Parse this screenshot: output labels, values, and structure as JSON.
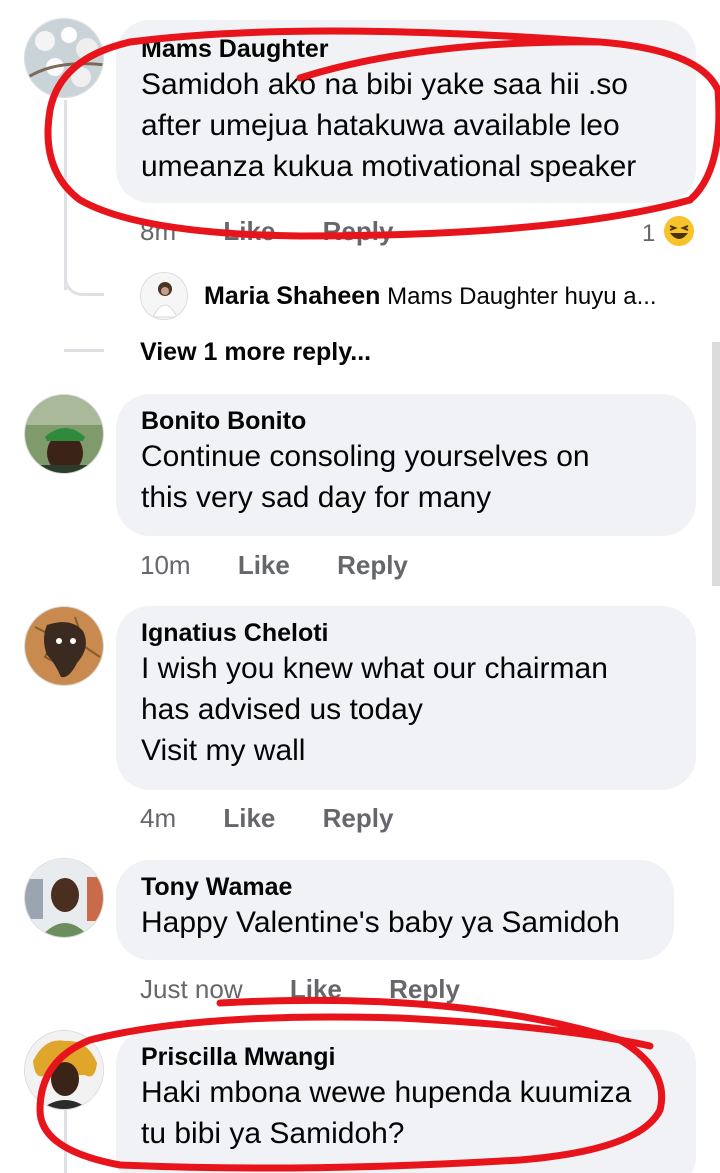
{
  "comments": [
    {
      "author": "Mams Daughter",
      "lines": [
        "Samidoh ako na bibi yake saa hii .so",
        "after umejua hatakuwa available leo",
        "umeanza kukua motivational speaker"
      ],
      "time": "8m",
      "like": "Like",
      "reply": "Reply",
      "reaction_count": "1",
      "reaction_icon": "laughing-emoji-icon"
    },
    {
      "author": "Bonito Bonito",
      "lines": [
        "Continue consoling yourselves on",
        "this very sad day for many"
      ],
      "time": "10m",
      "like": "Like",
      "reply": "Reply"
    },
    {
      "author": "Ignatius Cheloti",
      "lines": [
        "I wish you knew what our chairman",
        "has advised us today",
        "Visit my wall"
      ],
      "time": "4m",
      "like": "Like",
      "reply": "Reply"
    },
    {
      "author": "Tony Wamae",
      "lines": [
        "Happy Valentine's baby ya Samidoh"
      ],
      "time": "Just now",
      "like": "Like",
      "reply": "Reply"
    },
    {
      "author": "Priscilla Mwangi",
      "lines": [
        "Haki mbona wewe hupenda kuumiza",
        "tu bibi ya Samidoh?"
      ]
    }
  ],
  "reply_preview": {
    "author": "Maria Shaheen",
    "snippet": "Mams Daughter huyu a..."
  },
  "view_more": "View 1 more reply...",
  "colors": {
    "bubble": "#f0f2f5",
    "meta_text": "#65676b",
    "annotation": "#e8141b"
  }
}
